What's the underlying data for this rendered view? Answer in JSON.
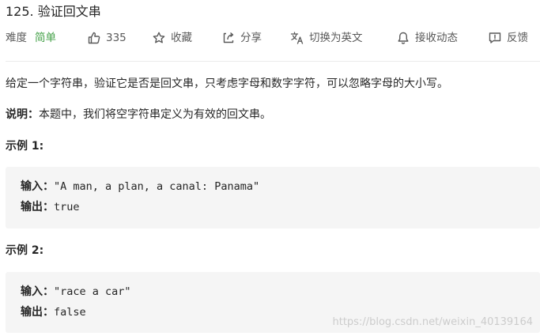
{
  "problem": {
    "title": "125. 验证回文串"
  },
  "meta": {
    "difficulty_label": "难度",
    "difficulty_value": "简单",
    "likes": "335",
    "favorite": "收藏",
    "share": "分享",
    "switch_language": "切换为英文",
    "notifications": "接收动态",
    "feedback": "反馈"
  },
  "description": {
    "text": "给定一个字符串，验证它是否是回文串，只考虑字母和数字字符，可以忽略字母的大小写。",
    "note_label": "说明：",
    "note_text": "本题中，我们将空字符串定义为有效的回文串。"
  },
  "examples": [
    {
      "heading": "示例 1:",
      "input_label": "输入：",
      "input_value": "\"A man, a plan, a canal: Panama\"",
      "output_label": "输出：",
      "output_value": "true"
    },
    {
      "heading": "示例 2:",
      "input_label": "输入：",
      "input_value": "\"race a car\"",
      "output_label": "输出：",
      "output_value": "false"
    }
  ],
  "watermark": "https://blog.csdn.net/weixin_40139164",
  "colors": {
    "difficulty_easy": "#43a047",
    "code_bg": "#f5f5f5"
  },
  "icons": {
    "likes": "thumbs-up-icon",
    "favorite": "star-icon",
    "share": "share-icon",
    "switch_language": "translate-icon",
    "notifications": "bell-icon",
    "feedback": "feedback-icon"
  }
}
